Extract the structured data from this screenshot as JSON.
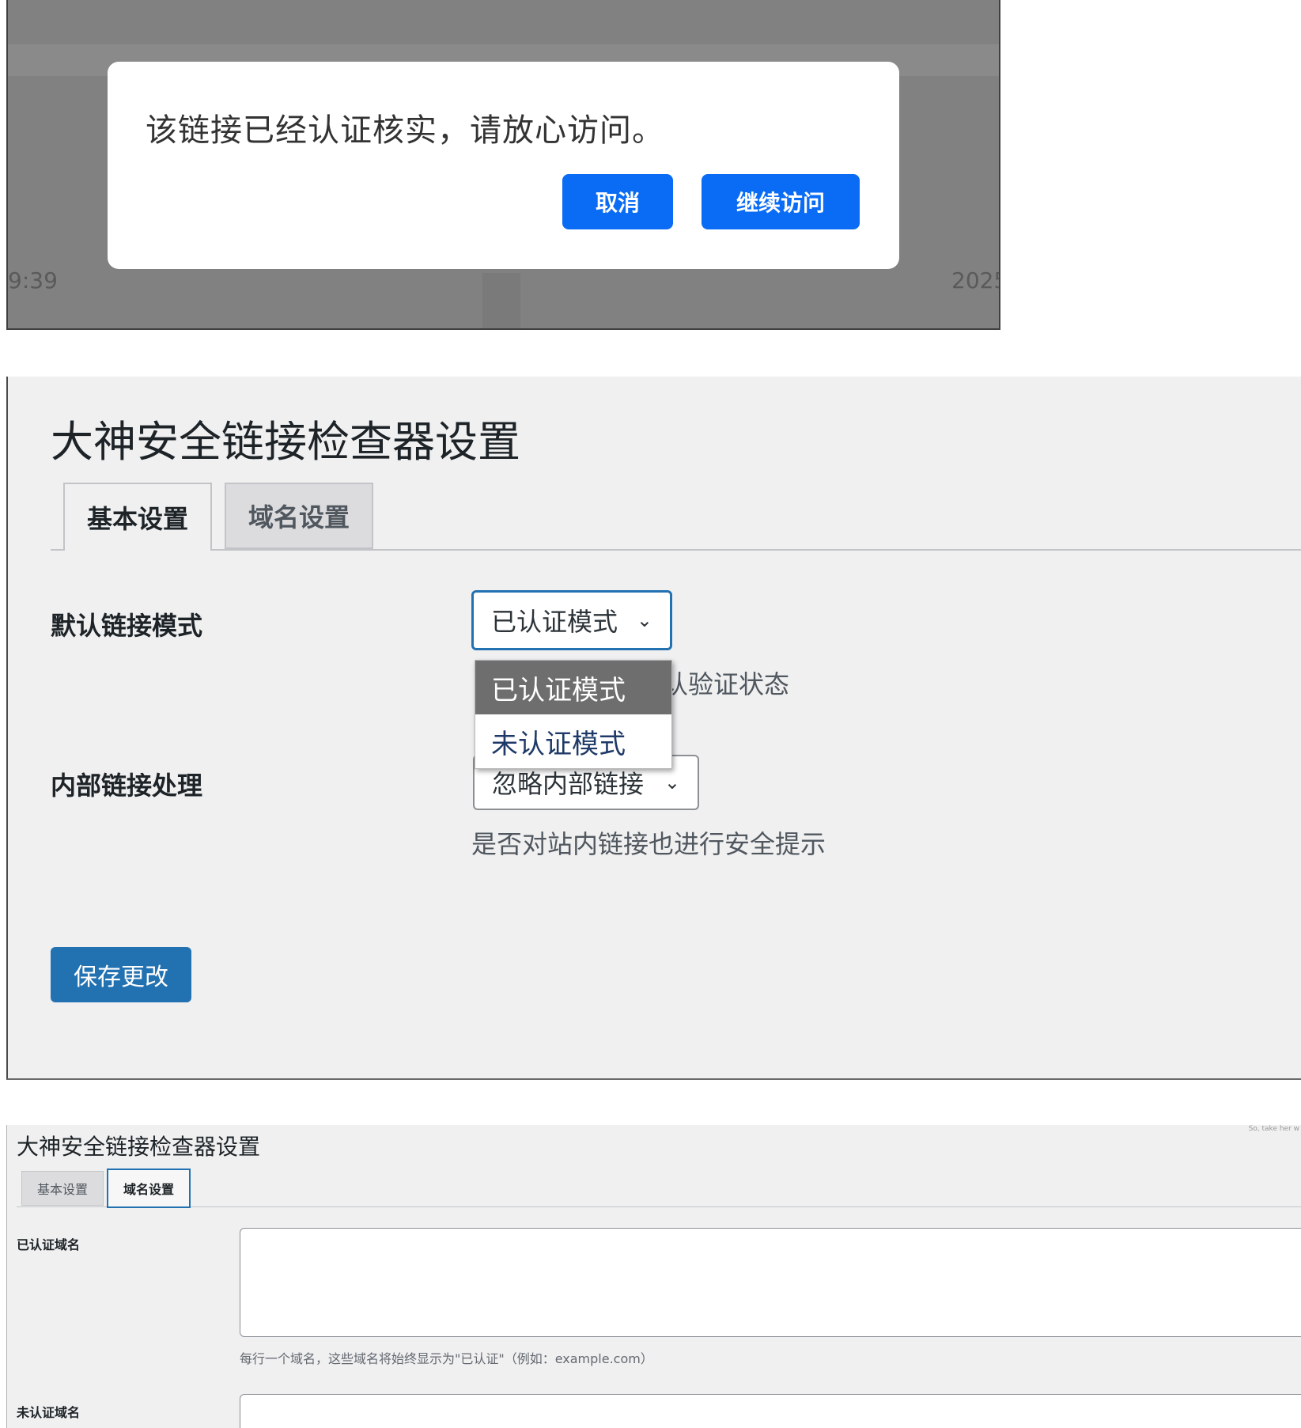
{
  "modal_panel": {
    "message": "该链接已经认证核实，请放心访问。",
    "cancel_label": "取消",
    "continue_label": "继续访问",
    "background_time": "9:39",
    "background_year": "2025",
    "colors": {
      "button": "#0a6cf5",
      "overlay": "#818181"
    }
  },
  "basic_panel": {
    "title": "大神安全链接检查器设置",
    "tabs": [
      {
        "label": "基本设置",
        "active": true
      },
      {
        "label": "域名设置",
        "active": false
      }
    ],
    "default_mode": {
      "label": "默认链接模式",
      "selected": "已认证模式",
      "options": [
        "已认证模式",
        "未认证模式"
      ],
      "description_visible": "默认验证状态"
    },
    "internal_links": {
      "label": "内部链接处理",
      "selected": "忽略内部链接",
      "description": "是否对站内链接也进行安全提示"
    },
    "save_label": "保存更改",
    "chevron_icon": "chevron-down-icon",
    "colors": {
      "primary": "#2271b1",
      "background": "#f0f0f1"
    }
  },
  "domain_panel": {
    "title": "大神安全链接检查器设置",
    "tabs": [
      {
        "label": "基本设置",
        "active": false
      },
      {
        "label": "域名设置",
        "active": true
      }
    ],
    "verified_domains": {
      "label": "已认证域名",
      "value": "",
      "description": "每行一个域名，这些域名将始终显示为\"已认证\"（例如：example.com）"
    },
    "unverified_domains": {
      "label": "未认证域名",
      "value": ""
    },
    "corner_text": "So, take her w"
  }
}
